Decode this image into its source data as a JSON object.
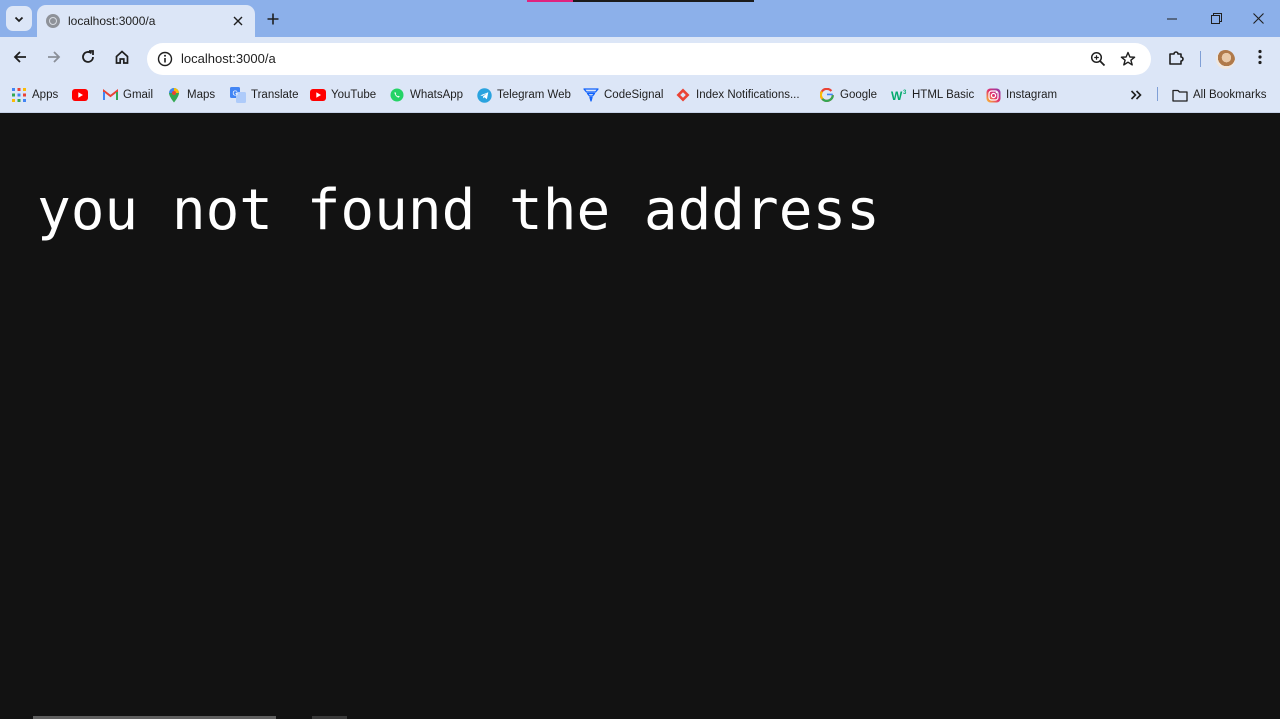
{
  "browser": {
    "tab": {
      "title": "localhost:3000/a",
      "favicon": "globe-icon"
    },
    "window_controls": [
      "minimize-icon",
      "restore-icon",
      "close-icon"
    ],
    "toolbar": {
      "url": "localhost:3000/a",
      "buttons": [
        "back-icon",
        "forward-icon",
        "reload-icon",
        "home-icon",
        "zoom-icon",
        "star-icon",
        "extensions-icon",
        "more-menu-icon"
      ]
    },
    "bookmarks": [
      {
        "label": "Apps",
        "icon": "apps-grid-icon"
      },
      {
        "label": "",
        "icon": "youtube-icon"
      },
      {
        "label": "Gmail",
        "icon": "gmail-icon"
      },
      {
        "label": "Maps",
        "icon": "maps-pin-icon"
      },
      {
        "label": "Translate",
        "icon": "translate-icon"
      },
      {
        "label": "YouTube",
        "icon": "youtube-icon"
      },
      {
        "label": "WhatsApp",
        "icon": "whatsapp-icon"
      },
      {
        "label": "Telegram Web",
        "icon": "telegram-icon"
      },
      {
        "label": "CodeSignal",
        "icon": "codesignal-icon"
      },
      {
        "label": "Index Notifications...",
        "icon": "index-icon"
      },
      {
        "label": "Google",
        "icon": "google-icon"
      },
      {
        "label": "HTML Basic",
        "icon": "w3schools-icon"
      },
      {
        "label": "Instagram",
        "icon": "instagram-icon"
      }
    ],
    "all_bookmarks_label": "All Bookmarks",
    "colors": {
      "tabstrip": "#8cb0ea",
      "toolbar": "#dce6f7",
      "page_bg": "#121212",
      "page_text": "#ffffff"
    }
  },
  "page": {
    "message": "you not found the address"
  }
}
